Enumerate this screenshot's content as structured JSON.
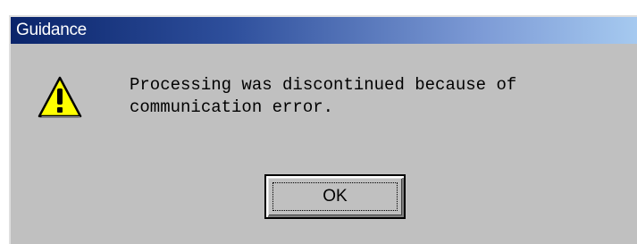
{
  "dialog": {
    "title": "Guidance",
    "icon": "warning-icon",
    "message_lines": [
      "Processing was discontinued because of",
      "communication error."
    ],
    "ok_label": "OK"
  },
  "colors": {
    "face": "#c0c0c0",
    "title_start": "#0a246a",
    "title_end": "#a6caf0",
    "warning_yellow": "#ffff00"
  }
}
